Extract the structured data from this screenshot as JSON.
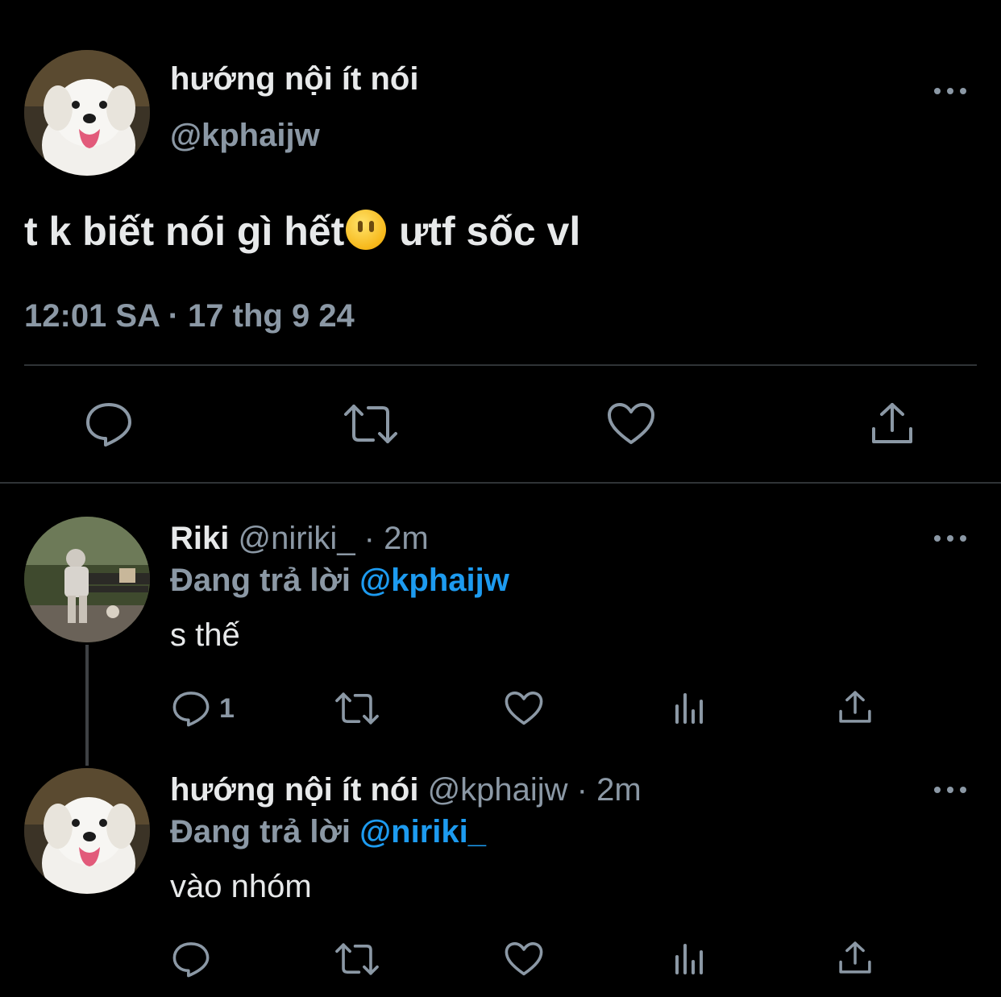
{
  "main_tweet": {
    "display_name": "hướng nội ít nói",
    "handle": "@kphaijw",
    "text_before": "t k biết nói gì hết",
    "emoji": "face-without-mouth",
    "text_after": " ưtf sốc vl",
    "timestamp": "12:01 SA · 17 thg 9 24",
    "actions": [
      "reply-icon",
      "retweet-icon",
      "like-icon",
      "share-icon"
    ]
  },
  "replies": [
    {
      "display_name": "Riki",
      "meta": "@niriki_ · 2m",
      "replying_label": "Đang trả lời",
      "replying_to": "@kphaijw",
      "text": "s thế",
      "reply_count": "1"
    },
    {
      "display_name": "hướng nội ít nói",
      "meta": "@kphaijw · 2m",
      "replying_label": "Đang trả lời",
      "replying_to": "@niriki_",
      "text": "vào nhóm",
      "reply_count": ""
    }
  ],
  "colors": {
    "background": "#000000",
    "text": "#e7e9ea",
    "muted": "#8b98a5",
    "link": "#1d9bf0",
    "divider": "#2f3336"
  }
}
